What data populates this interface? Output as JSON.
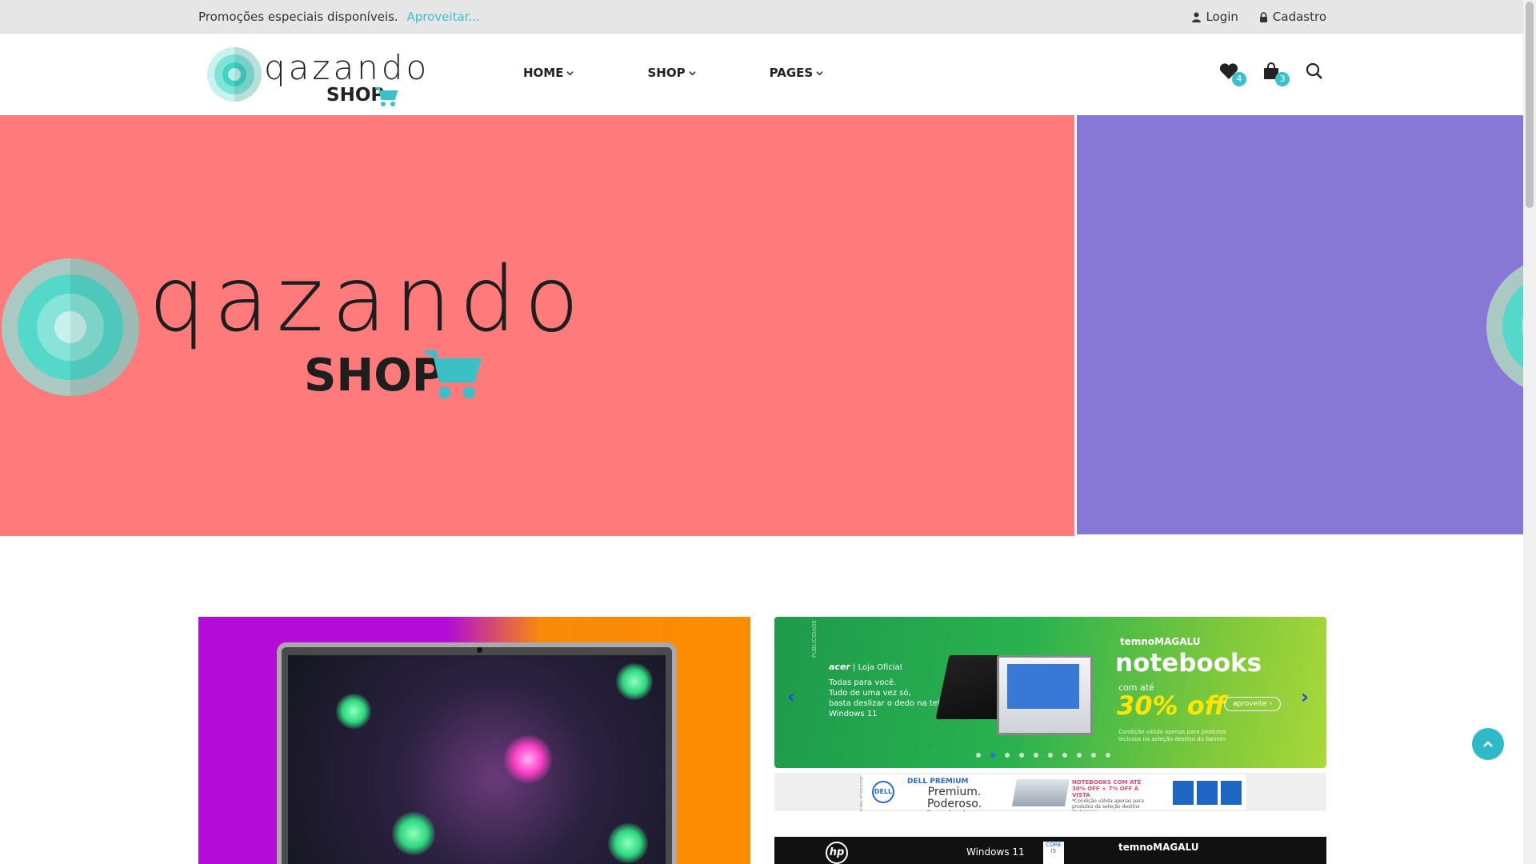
{
  "topbar": {
    "promo_text": "Promoções especiais disponíveis.",
    "promo_link": "Aproveitar...",
    "login": "Login",
    "register": "Cadastro"
  },
  "header": {
    "logo_word": "qazando",
    "logo_shop": "SHOP",
    "nav": [
      {
        "label": "HOME"
      },
      {
        "label": "SHOP"
      },
      {
        "label": "PAGES"
      }
    ],
    "wishlist_count": "4",
    "cart_count": "3"
  },
  "hero": {
    "logo_word": "qazando",
    "logo_shop": "SHOP"
  },
  "banner_right": {
    "acer_brand": "acer",
    "acer_store": "| Loja Oficial",
    "acer_line1": "Todas para você.",
    "acer_line2": "Tudo de uma vez só,",
    "acer_line3": "basta deslizar o dedo na tela.",
    "windows": "Windows 11",
    "temnomagalu": "temnoMAGALU",
    "notebooks": "notebooks",
    "com_ate": "com até",
    "discount": "30% off",
    "cta": "aproveite ›",
    "condition": "Condição válida apenas para produtos inclusos na seleção destino do banner.",
    "side_label": "PUBLICIDADE",
    "slides_total": 10,
    "slide_active": 2
  },
  "banner_strip": {
    "dell": "DELL",
    "dell_premium": "DELL PREMIUM",
    "tagline": "Premium. Poderoso. Produtivo.",
    "notebooks_offer": "NOTEBOOKS COM ATÉ 30% OFF + 7% OFF À VISTA",
    "condition": "*Condição válida apenas para produtos da seleção destino do banner.",
    "side_label": "PUBLICIDADE"
  },
  "banner_hp": {
    "hp": "hp",
    "windows": "Windows 11",
    "core": "CORE i5",
    "temnomagalu": "temnoMAGALU"
  },
  "colors": {
    "accent": "#3cc0c7",
    "hero_main": "#ff7a7a",
    "hero_side": "#8878d6"
  }
}
